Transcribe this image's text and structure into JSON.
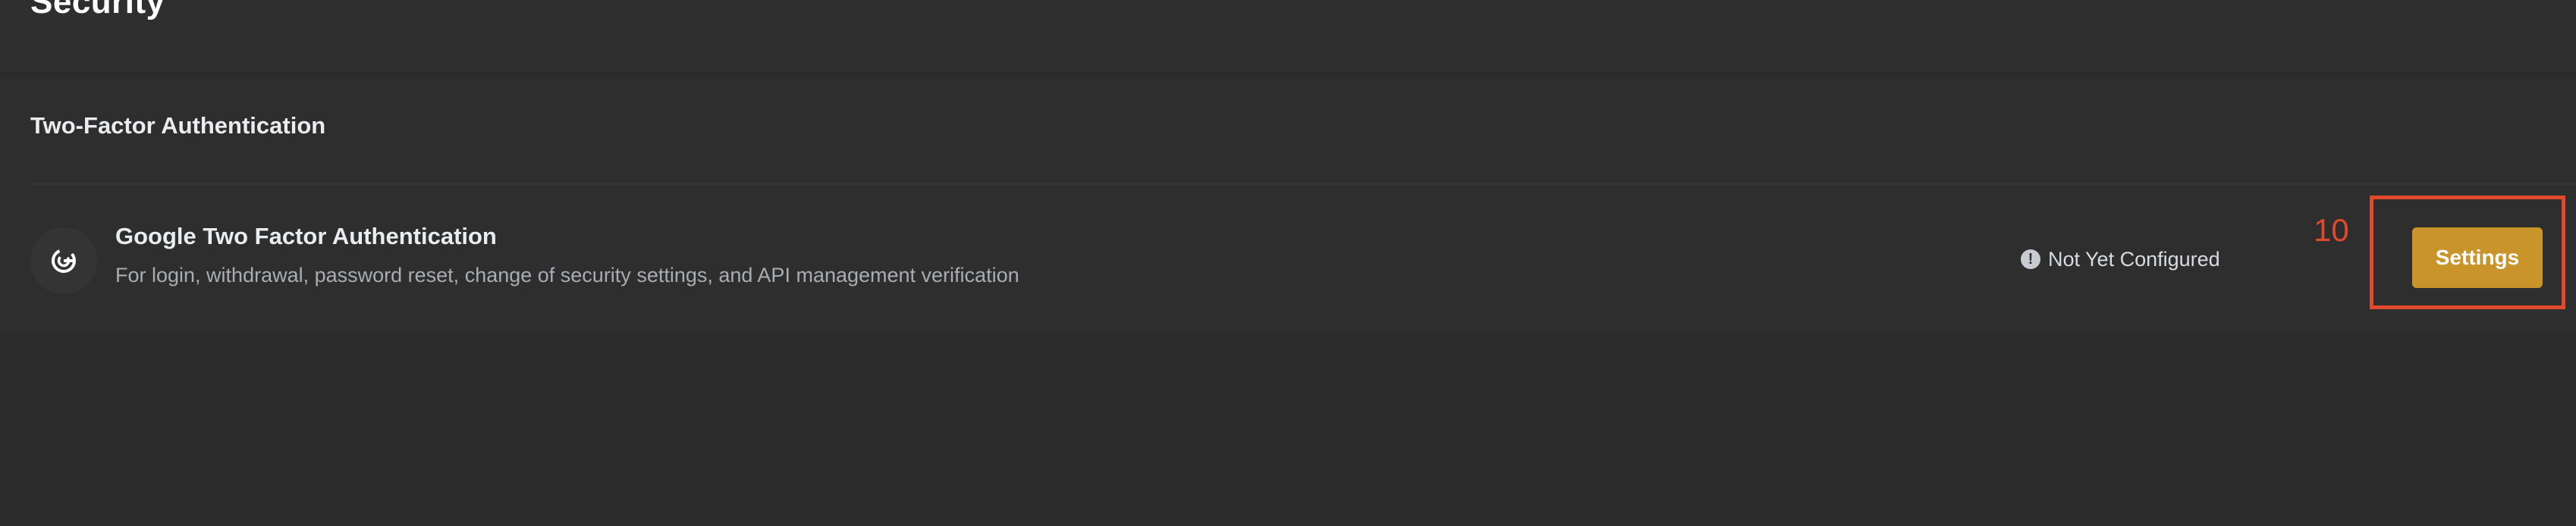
{
  "page": {
    "title": "Security"
  },
  "section": {
    "title": "Two-Factor Authentication"
  },
  "item": {
    "icon": "google-authenticator-icon",
    "title": "Google Two Factor Authentication",
    "description": "For login, withdrawal, password reset, change of security settings, and API management verification",
    "status_icon": "alert-circle-icon",
    "status": "Not Yet Configured",
    "button_label": "Settings"
  },
  "annotation": {
    "label": "10",
    "color": "#e0492b"
  },
  "colors": {
    "background": "#2b2b2b",
    "card": "#2e2e2e",
    "accent": "#c99429",
    "text_primary": "#eaecef",
    "text_secondary": "#a9acb2"
  }
}
